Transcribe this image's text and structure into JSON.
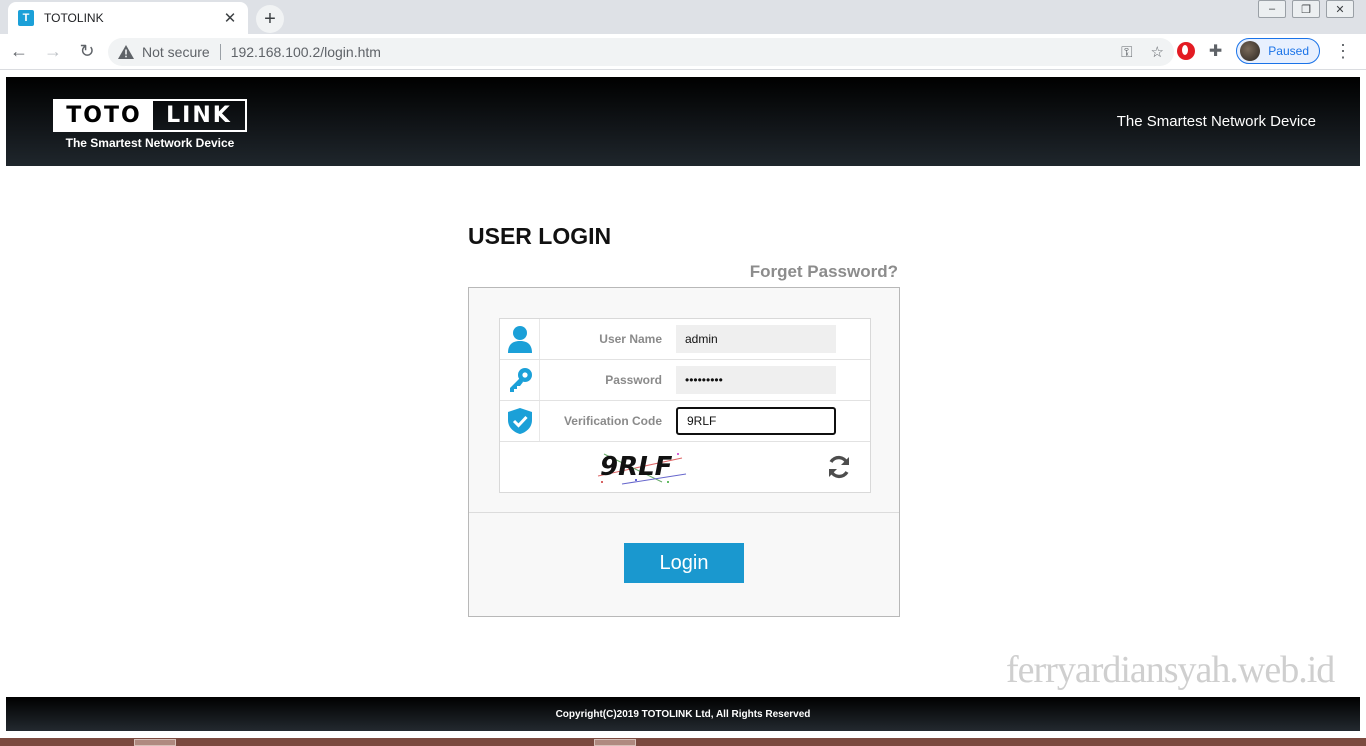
{
  "browser": {
    "tab_title": "TOTOLINK",
    "tab_favicon_letter": "T",
    "not_secure": "Not secure",
    "url": "192.168.100.2/login.htm",
    "profile_status": "Paused"
  },
  "header": {
    "logo_left": "TOTO",
    "logo_right": "LINK",
    "logo_tagline": "The Smartest Network Device",
    "tagline": "The Smartest Network Device"
  },
  "login": {
    "title": "USER LOGIN",
    "forget_password": "Forget Password?",
    "username_label": "User Name",
    "username_value": "admin",
    "password_label": "Password",
    "password_value": "•••••••••",
    "verification_label": "Verification Code",
    "verification_value": "9RLF",
    "captcha_text": "9RLF",
    "login_button": "Login"
  },
  "watermark": "ferryardiansyah.web.id",
  "footer": {
    "copyright": "Copyright(C)2019 TOTOLINK Ltd, All Rights Reserved"
  },
  "colors": {
    "accent": "#1a98cf",
    "icon": "#1ba0d8",
    "header_bg": "#000000"
  }
}
